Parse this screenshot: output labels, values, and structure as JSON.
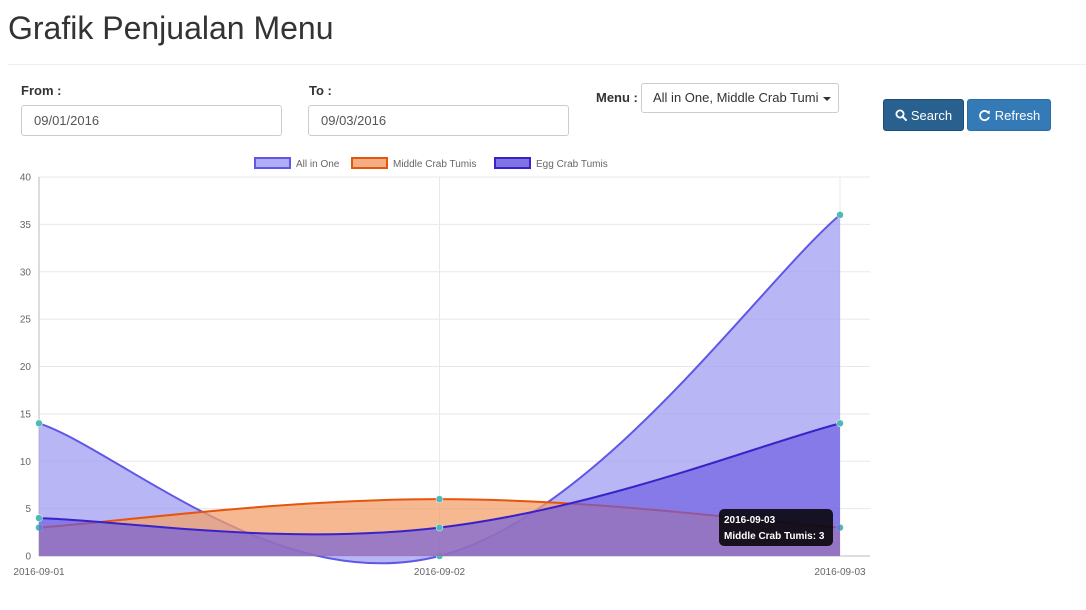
{
  "page": {
    "title": "Grafik Penjualan Menu"
  },
  "filters": {
    "from_label": "From :",
    "from_value": "09/01/2016",
    "to_label": "To :",
    "to_value": "09/03/2016",
    "menu_label": "Menu :",
    "menu_value": "All in One, Middle Crab Tumi"
  },
  "buttons": {
    "search_label": "Search",
    "refresh_label": "Refresh"
  },
  "icons": {
    "search": "search-icon",
    "refresh": "refresh-icon"
  },
  "colors": {
    "search_button": "#286090",
    "refresh_button": "#337ab7"
  },
  "chart_data": {
    "type": "area",
    "x": [
      "2016-09-01",
      "2016-09-02",
      "2016-09-03"
    ],
    "ylim": [
      0,
      40
    ],
    "yticks": [
      0,
      5,
      10,
      15,
      20,
      25,
      30,
      35,
      40
    ],
    "grid": true,
    "legend_position": "top-center",
    "series": [
      {
        "name": "All in One",
        "values": [
          14,
          0,
          36
        ],
        "line_color": "#6057e6",
        "fill_color": "#a29df3",
        "fill_opacity": 0.75
      },
      {
        "name": "Middle Crab Tumis",
        "values": [
          3,
          6,
          3
        ],
        "line_color": "#e6540d",
        "fill_color": "#f2a06c",
        "fill_opacity": 0.75
      },
      {
        "name": "Egg Crab Tumis",
        "values": [
          4,
          3,
          14
        ],
        "line_color": "#3a22c9",
        "fill_color": "#6a5ae0",
        "fill_opacity": 0.65
      }
    ],
    "point_color": "#4fb8b8",
    "tooltip": {
      "title": "2016-09-03",
      "body": "Middle Crab Tumis: 3"
    }
  }
}
